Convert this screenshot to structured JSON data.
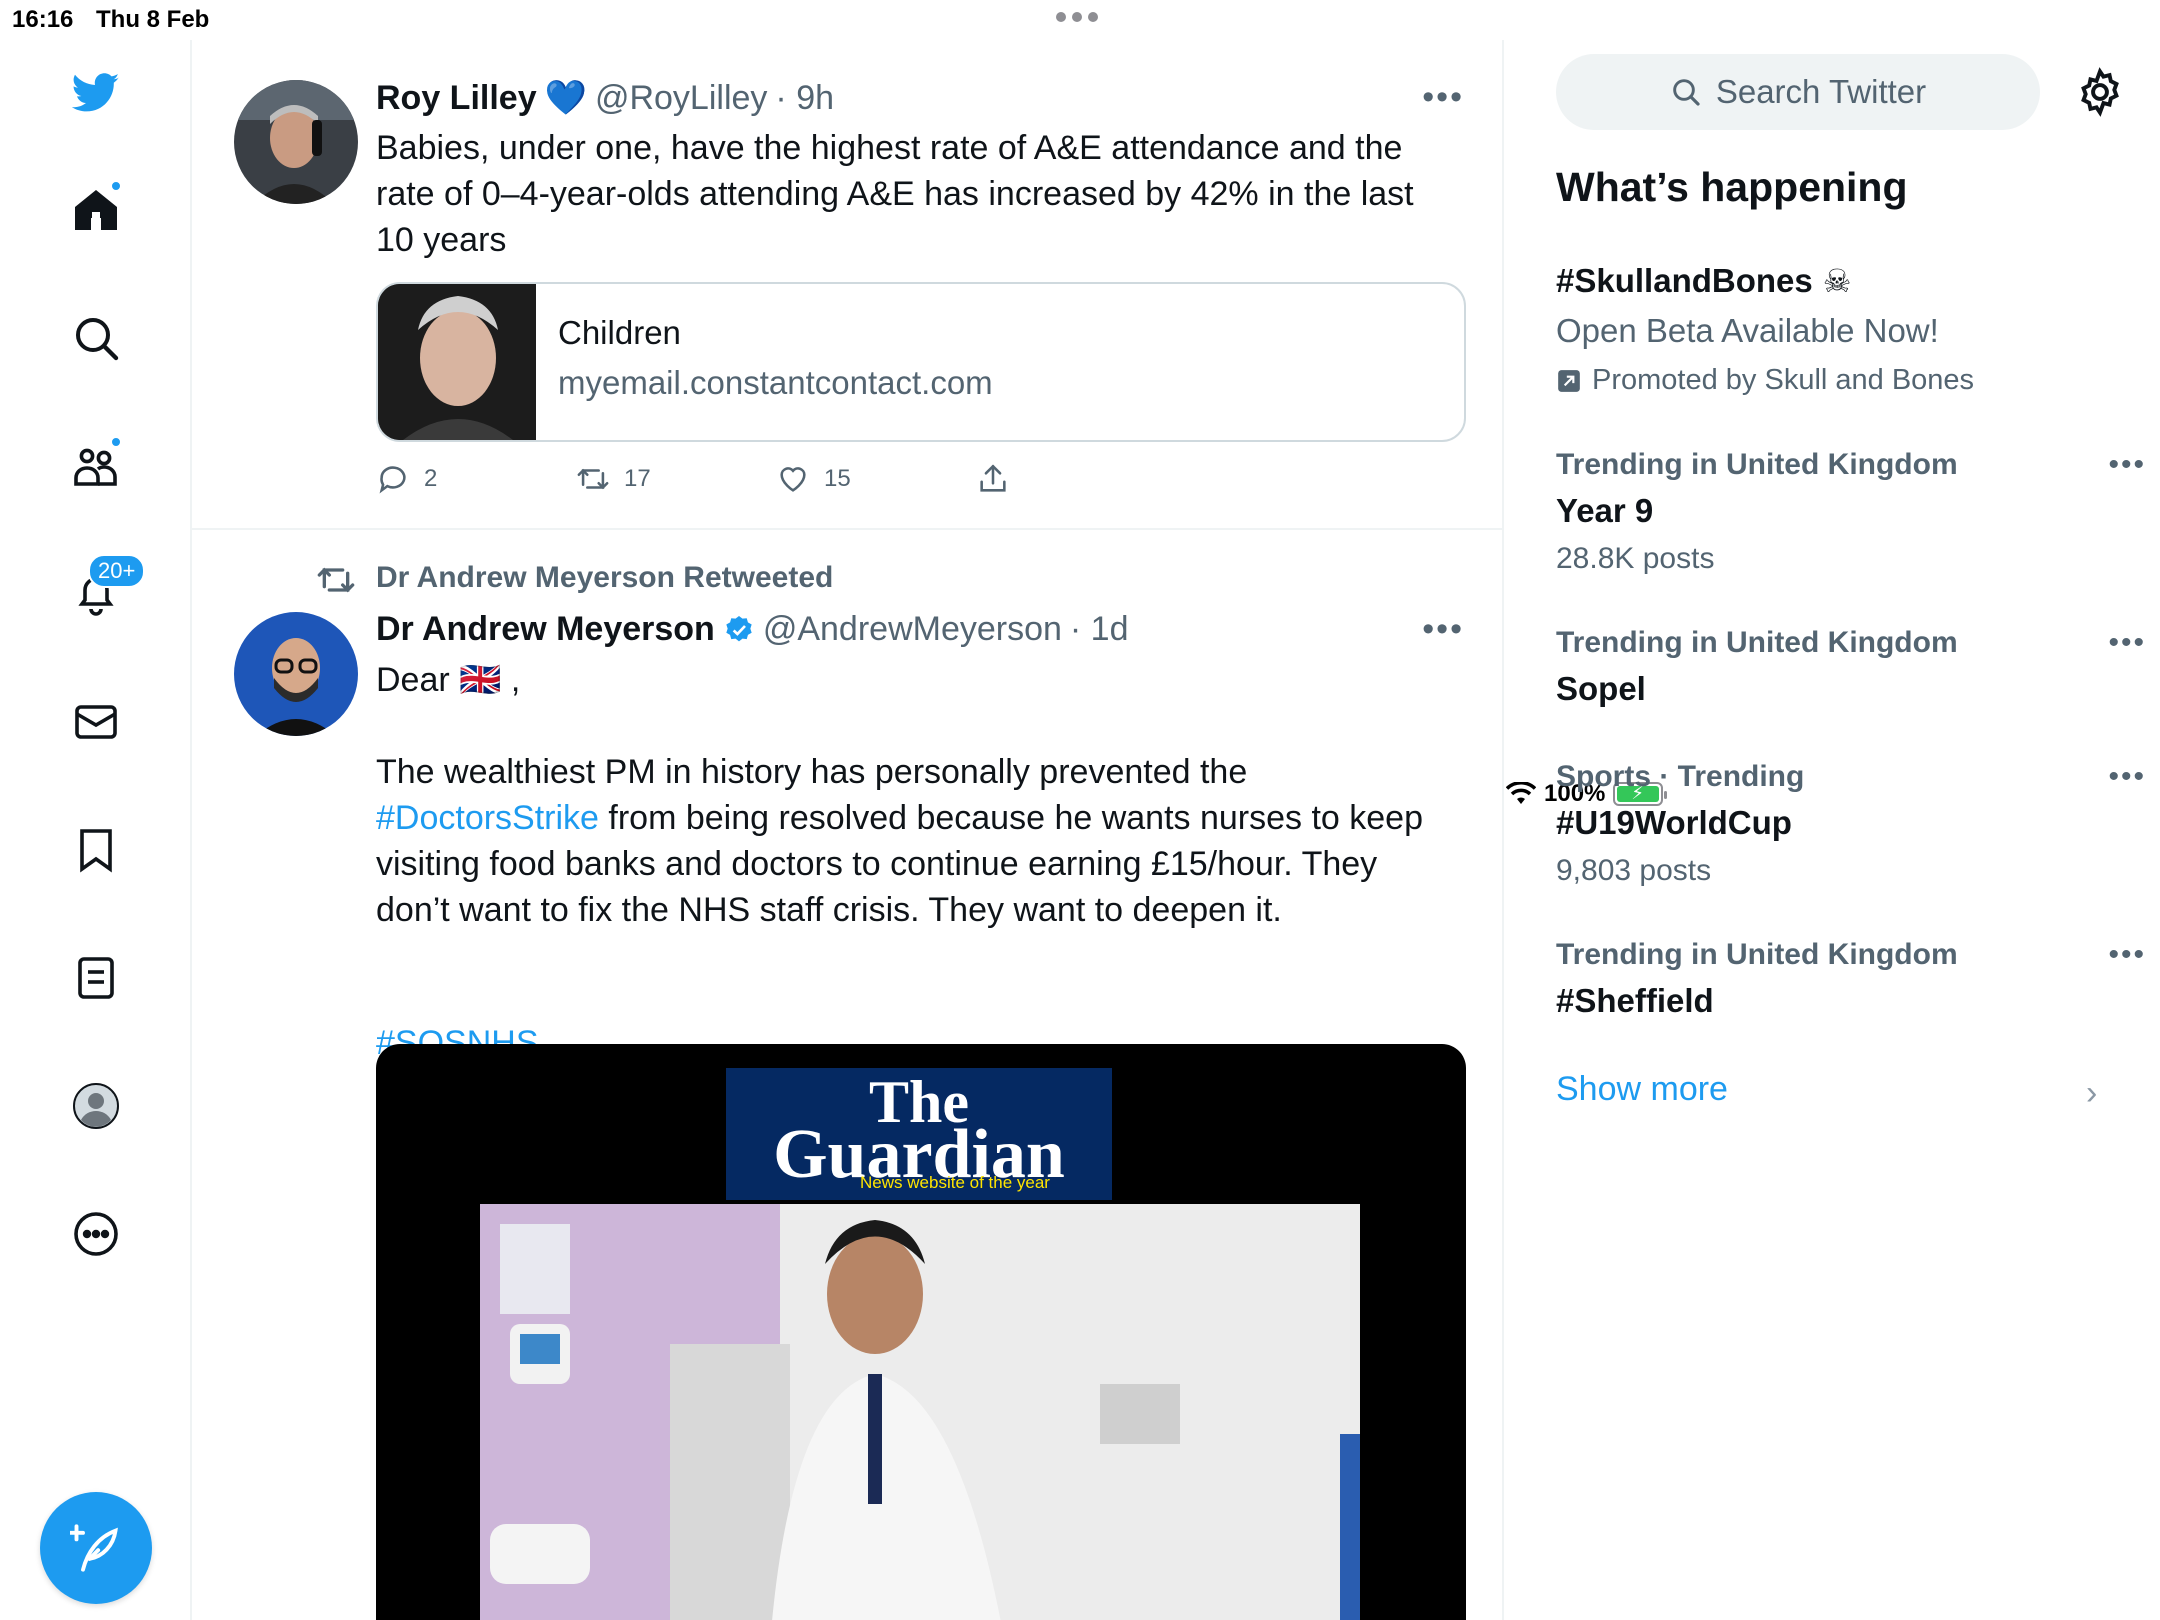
{
  "statusbar": {
    "time": "16:16",
    "date": "Thu 8 Feb",
    "battery": "100%"
  },
  "colors": {
    "accent": "#1d9bf0",
    "text": "#0f1419",
    "muted": "#536471",
    "border": "#eff3f4"
  },
  "nav": {
    "items": [
      "twitter-logo",
      "home",
      "explore",
      "communities",
      "notifications",
      "messages",
      "bookmarks",
      "lists",
      "profile",
      "more"
    ],
    "notifications_badge": "20+"
  },
  "tweets": [
    {
      "name": "Roy Lilley",
      "handle": "@RoyLilley",
      "time": "· 9h",
      "text": "Babies, under one, have the highest rate of A&E attendance and the rate of 0–4-year-olds attending A&E has increased by 42% in the last 10 years",
      "card": {
        "title": "Children",
        "url": "myemail.constantcontact.com"
      },
      "replies": "2",
      "retweets": "17",
      "likes": "15"
    },
    {
      "retweeted_by": "Dr Andrew Meyerson Retweeted",
      "name": "Dr Andrew Meyerson",
      "handle": "@AndrewMeyerson",
      "time": "· 1d",
      "line1": "Dear 🇬🇧 ,",
      "para_a": "The wealthiest PM in history has personally prevented the ",
      "hashtag1": "#DoctorsStrike",
      "para_b": " from being resolved because he wants nurses to keep visiting food banks and doctors to continue earning £15/hour. They don’t want to fix the NHS staff crisis. They want to deepen it.",
      "hashtag2": "#SOSNHS",
      "media": {
        "masthead_1": "The",
        "masthead_2": "Guardian",
        "tagline": "News website of the year"
      }
    }
  ],
  "sidebar": {
    "search_placeholder": "Search Twitter",
    "title": "What’s happening",
    "promoted": {
      "topic": "#SkullandBones",
      "sub": "Open Beta Available Now!",
      "by": "Promoted by Skull and Bones"
    },
    "trends": [
      {
        "meta": "Trending in United Kingdom",
        "topic": "Year 9",
        "posts": "28.8K posts"
      },
      {
        "meta": "Trending in United Kingdom",
        "topic": "Sopel",
        "posts": ""
      },
      {
        "meta": "Sports · Trending",
        "topic": "#U19WorldCup",
        "posts": "9,803 posts"
      },
      {
        "meta": "Trending in United Kingdom",
        "topic": "#Sheffield",
        "posts": ""
      }
    ],
    "show_more": "Show more"
  }
}
